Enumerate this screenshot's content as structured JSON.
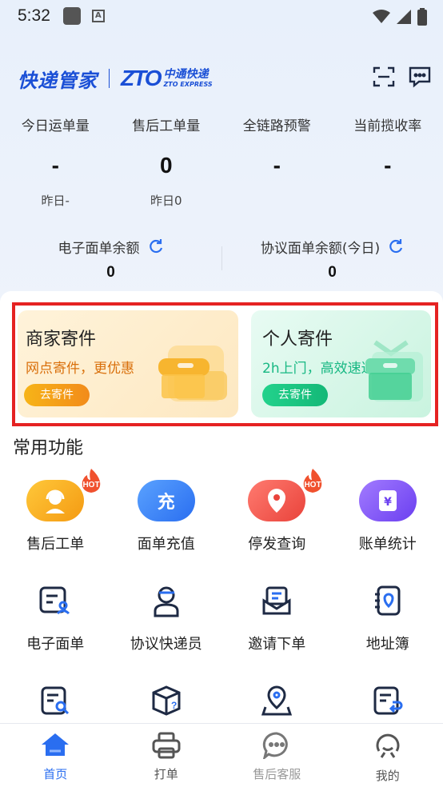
{
  "status_bar": {
    "time": "5:32",
    "a_label": "A"
  },
  "header": {
    "brand": "快递管家",
    "partner_logo_text": "ZTO",
    "partner_cn": "中通快递",
    "partner_en": "ZTO EXPRESS",
    "icons": [
      "scan-icon",
      "message-icon"
    ]
  },
  "stats": [
    {
      "label": "今日运单量",
      "value": "-",
      "yesterday": "昨日-"
    },
    {
      "label": "售后工单量",
      "value": "0",
      "yesterday": "昨日0"
    },
    {
      "label": "全链路预警",
      "value": "-",
      "yesterday": ""
    },
    {
      "label": "当前揽收率",
      "value": "-",
      "yesterday": ""
    }
  ],
  "balances": [
    {
      "label": "电子面单余额",
      "value": "0"
    },
    {
      "label": "协议面单余额(今日)",
      "value": "0"
    }
  ],
  "ship_cards": [
    {
      "title": "商家寄件",
      "subtitle": "网点寄件，更优惠",
      "button": "去寄件"
    },
    {
      "title": "个人寄件",
      "subtitle": "2h上门，高效速达",
      "button": "去寄件"
    }
  ],
  "section_title": "常用功能",
  "functions": [
    {
      "label": "售后工单",
      "icon": "headset-icon",
      "hot": true,
      "color": "#f5a623"
    },
    {
      "label": "面单充值",
      "icon": "recharge-icon",
      "glyph": "充",
      "hot": false,
      "color": "#3b82f6"
    },
    {
      "label": "停发查询",
      "icon": "location-pin-icon",
      "hot": true,
      "color": "#ef5350"
    },
    {
      "label": "账单统计",
      "icon": "bill-icon",
      "glyph": "¥",
      "hot": false,
      "color": "#7c4dff"
    },
    {
      "label": "电子面单",
      "icon": "e-waybill-icon"
    },
    {
      "label": "协议快递员",
      "icon": "courier-icon"
    },
    {
      "label": "邀请下单",
      "icon": "invite-order-icon"
    },
    {
      "label": "地址簿",
      "icon": "address-book-icon"
    },
    {
      "label": "",
      "icon": "search-doc-icon"
    },
    {
      "label": "",
      "icon": "package-question-icon"
    },
    {
      "label": "",
      "icon": "map-pin-icon"
    },
    {
      "label": "",
      "icon": "return-doc-icon"
    }
  ],
  "hot_badge": "HOT",
  "tabs": [
    {
      "label": "首页",
      "icon": "home-icon",
      "active": true
    },
    {
      "label": "打单",
      "icon": "printer-icon",
      "active": false
    },
    {
      "label": "售后客服",
      "icon": "chat-icon",
      "active": false,
      "dim": true
    },
    {
      "label": "我的",
      "icon": "profile-icon",
      "active": false
    }
  ]
}
